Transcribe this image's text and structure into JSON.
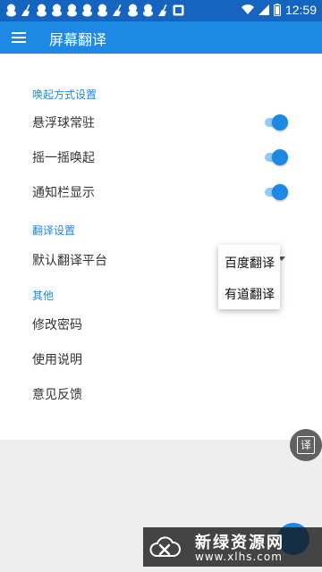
{
  "status_bar": {
    "time": "12:59",
    "notification_icons": [
      "qq-icon",
      "broom-icon",
      "qq-icon",
      "qq-icon",
      "qq-icon",
      "qq-icon",
      "qq-icon",
      "broom-icon",
      "qq-icon",
      "qq-icon",
      "broom-icon",
      "app-badge-icon"
    ],
    "wifi_icon": "wifi-icon",
    "battery_icon": "battery-icon",
    "signal_icon": "signal-icon"
  },
  "app_bar": {
    "title": "屏幕翻译",
    "menu_icon": "menu-icon"
  },
  "sections": [
    {
      "header": "唤起方式设置",
      "items": [
        {
          "label": "悬浮球常驻",
          "toggle_on": true
        },
        {
          "label": "摇一摇唤起",
          "toggle_on": true
        },
        {
          "label": "通知栏显示",
          "toggle_on": true
        }
      ]
    },
    {
      "header": "翻译设置",
      "items": [
        {
          "label": "默认翻译平台"
        }
      ]
    },
    {
      "header": "其他",
      "items": [
        {
          "label": "修改密码"
        },
        {
          "label": "使用说明"
        },
        {
          "label": "意见反馈"
        }
      ]
    }
  ],
  "platform_popup": {
    "options": [
      "百度翻译",
      "有道翻译"
    ]
  },
  "float_ball": {
    "label": "译"
  },
  "watermark": {
    "title": "新绿资源网",
    "url": "www.xlhs.com"
  },
  "colors": {
    "primary": "#1e88e5",
    "status_bar": "#1565c0",
    "toggle_track": "#90caf9"
  }
}
